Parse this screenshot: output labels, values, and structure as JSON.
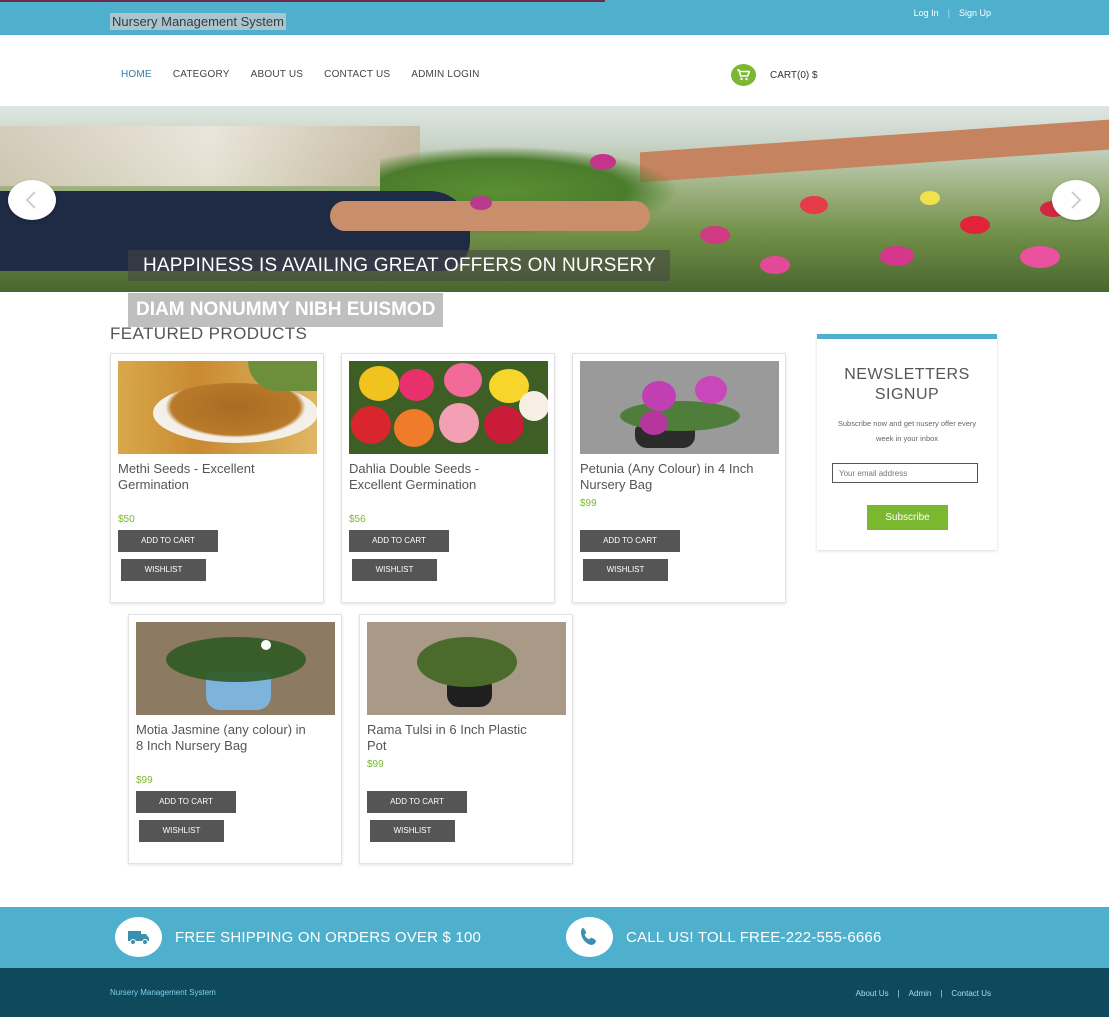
{
  "header": {
    "site_title": "Nursery Management System",
    "login_label": "Log In",
    "signup_label": "Sign Up"
  },
  "nav": {
    "items": [
      "HOME",
      "CATEGORY",
      "ABOUT US",
      "CONTACT US",
      "ADMIN LOGIN"
    ],
    "active": "HOME"
  },
  "cart": {
    "label": "CART(0) $",
    "icon": "cart-icon"
  },
  "hero": {
    "caption_primary": "HAPPINESS IS AVAILING GREAT OFFERS ON NURSERY",
    "caption_secondary": "DIAM NONUMMY NIBH EUISMOD"
  },
  "featured": {
    "title": "FEATURED PRODUCTS",
    "add_to_cart_label": "ADD TO CART",
    "wishlist_label": "WISHLIST",
    "products": [
      {
        "name": "Methi Seeds - Excellent Germination",
        "price": "$50"
      },
      {
        "name": "Dahlia Double Seeds - Excellent Germination",
        "price": "$56"
      },
      {
        "name": "Petunia (Any Colour) in 4 Inch Nursery Bag",
        "price": "$99"
      },
      {
        "name": "Motia Jasmine (any colour) in 8 Inch Nursery Bag",
        "price": "$99"
      },
      {
        "name": "Rama Tulsi in 6 Inch Plastic Pot",
        "price": "$99"
      }
    ]
  },
  "newsletter": {
    "title": "NEWSLETTERS SIGNUP",
    "text": "Subscribe now and get nusery offer every week in your inbox",
    "placeholder": "Your email address",
    "button_label": "Subscribe"
  },
  "promo": {
    "shipping_text": "FREE SHIPPING ON ORDERS OVER $ 100",
    "call_text": "CALL US! TOLL FREE-222-555-6666",
    "accent_color": "#4eb0cc"
  },
  "footer": {
    "title": "Nursery Management System",
    "links": [
      "About Us",
      "Admin",
      "Contact Us"
    ],
    "background_color": "#0f4a5c"
  },
  "colors": {
    "brand": "#4eb0cc",
    "green_accent": "#7ab82f",
    "button_dark": "#555555"
  }
}
